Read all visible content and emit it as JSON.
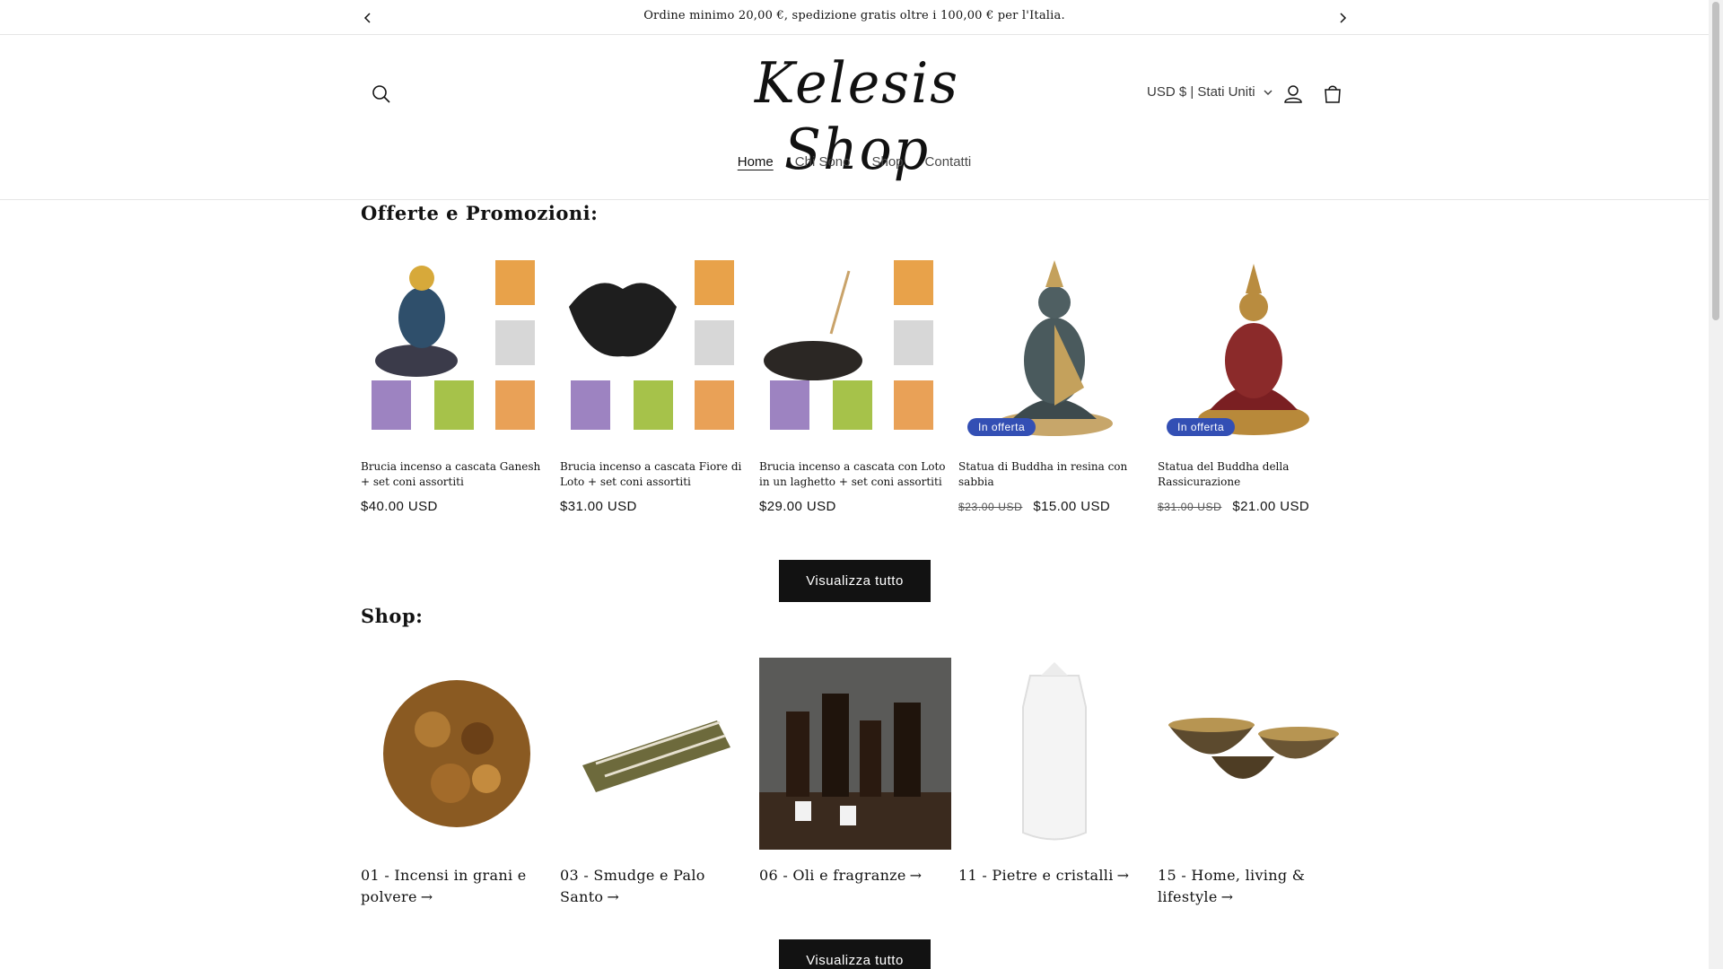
{
  "announcement": {
    "text": "Ordine minimo 20,00 €, spedizione gratis oltre i 100,00 € per l'Italia.",
    "prev_icon": "chevron-left-icon",
    "next_icon": "chevron-right-icon"
  },
  "header": {
    "logo": "Kelesis Shop",
    "currency": "USD $ | Stati Uniti",
    "icons": [
      "search-icon",
      "account-icon",
      "cart-icon"
    ]
  },
  "nav": {
    "items": [
      {
        "label": "Home",
        "active": true
      },
      {
        "label": "Chi Sono",
        "active": false
      },
      {
        "label": "Shop",
        "active": false
      },
      {
        "label": "Contatti",
        "active": false
      }
    ]
  },
  "offers": {
    "title": "Offerte e Promozioni:",
    "products": [
      {
        "title": "Brucia incenso a cascata Ganesh + set coni assortiti",
        "price": "$40.00 USD",
        "old_price": "",
        "badge": ""
      },
      {
        "title": "Brucia incenso a cascata Fiore di Loto + set coni assortiti",
        "price": "$31.00 USD",
        "old_price": "",
        "badge": ""
      },
      {
        "title": "Brucia incenso a cascata con Loto in un laghetto + set coni assortiti",
        "price": "$29.00 USD",
        "old_price": "",
        "badge": ""
      },
      {
        "title": "Statua di Buddha in resina con sabbia",
        "price": "$15.00 USD",
        "old_price": "$23.00 USD",
        "badge": "In offerta"
      },
      {
        "title": "Statua del Buddha della Rassicurazione",
        "price": "$21.00 USD",
        "old_price": "$31.00 USD",
        "badge": "In offerta"
      }
    ],
    "view_all": "Visualizza tutto"
  },
  "shop": {
    "title": "Shop:",
    "collections": [
      {
        "title": "01 - Incensi in grani e polvere"
      },
      {
        "title": "03 - Smudge e Palo Santo"
      },
      {
        "title": "06 - Oli e fragranze"
      },
      {
        "title": "11 - Pietre e cristalli"
      },
      {
        "title": "15 - Home, living & lifestyle"
      }
    ],
    "view_all": "Visualizza tutto"
  },
  "colors": {
    "badge": "#334fb4",
    "button": "#121212",
    "text": "#121212"
  }
}
